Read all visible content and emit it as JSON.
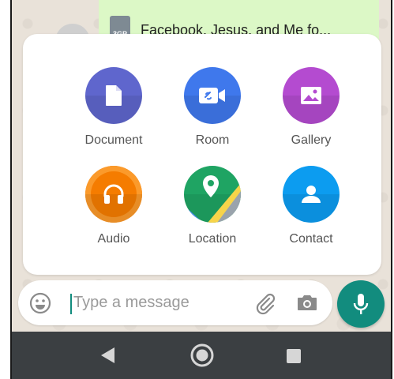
{
  "chat": {
    "file_type": "3GP",
    "file_name": "Facebook, Jesus, and Me fo..."
  },
  "attachments": [
    {
      "label": "Document",
      "icon": "document-icon",
      "color": "#5f66cd"
    },
    {
      "label": "Room",
      "icon": "video-link-icon",
      "color": "#3f78ec"
    },
    {
      "label": "Gallery",
      "icon": "image-icon",
      "color": "#b44bd0"
    },
    {
      "label": "Audio",
      "icon": "headphones-icon",
      "color": "#f57c00"
    },
    {
      "label": "Location",
      "icon": "map-pin-icon",
      "color": "#1fa463"
    },
    {
      "label": "Contact",
      "icon": "person-icon",
      "color": "#0c9cf0"
    }
  ],
  "composer": {
    "placeholder": "Type a message",
    "accent": "#128c7e"
  },
  "navbar": {
    "back_icon": "back-triangle-icon",
    "home_icon": "home-circle-icon",
    "recent_icon": "recent-square-icon"
  }
}
